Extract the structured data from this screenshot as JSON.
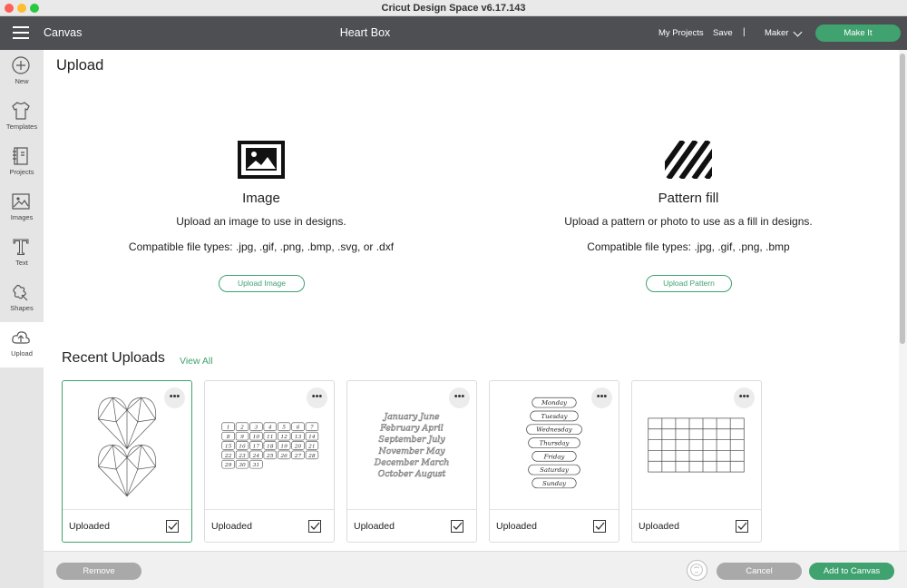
{
  "window": {
    "title": "Cricut Design Space  v6.17.143"
  },
  "header": {
    "menu_icon": "hamburger-icon",
    "section": "Canvas",
    "project_title": "Heart Box",
    "my_projects": "My Projects",
    "save": "Save",
    "separator": "|",
    "machine": "Maker",
    "make_it": "Make It"
  },
  "sidebar": {
    "items": [
      {
        "label": "New",
        "icon": "plus-circle-icon"
      },
      {
        "label": "Templates",
        "icon": "shirt-icon"
      },
      {
        "label": "Projects",
        "icon": "notebook-icon"
      },
      {
        "label": "Images",
        "icon": "image-icon"
      },
      {
        "label": "Text",
        "icon": "text-icon"
      },
      {
        "label": "Shapes",
        "icon": "shapes-icon"
      },
      {
        "label": "Upload",
        "icon": "upload-cloud-icon",
        "active": true
      }
    ]
  },
  "main": {
    "title": "Upload",
    "image_upload": {
      "title": "Image",
      "description": "Upload an image to use in designs.",
      "types": "Compatible file types: .jpg, .gif, .png, .bmp, .svg, or .dxf",
      "button": "Upload Image"
    },
    "pattern_upload": {
      "title": "Pattern fill",
      "description": "Upload a pattern or photo to use as a fill in designs.",
      "types": "Compatible file types: .jpg, .gif, .png, .bmp",
      "button": "Upload Pattern"
    },
    "recent": {
      "title": "Recent Uploads",
      "view_all": "View All",
      "more_label": "•••",
      "items": [
        {
          "label": "Uploaded",
          "thumb": "geometric-hearts",
          "selected": true
        },
        {
          "label": "Uploaded",
          "thumb": "number-tags",
          "numbers": [
            "1",
            "2",
            "3",
            "4",
            "5",
            "6",
            "7",
            "8",
            "9",
            "10",
            "11",
            "12",
            "13",
            "14",
            "15",
            "16",
            "17",
            "18",
            "19",
            "20",
            "21",
            "22",
            "23",
            "24",
            "25",
            "26",
            "27",
            "28",
            "29",
            "30",
            "31"
          ]
        },
        {
          "label": "Uploaded",
          "thumb": "month-script",
          "words": [
            "January",
            "June",
            "February",
            "April",
            "September",
            "July",
            "November",
            "May",
            "December",
            "March",
            "October",
            "August"
          ]
        },
        {
          "label": "Uploaded",
          "thumb": "weekday-tags",
          "words": [
            "Monday",
            "Tuesday",
            "Wednesday",
            "Thursday",
            "Friday",
            "Saturday",
            "Sunday"
          ]
        },
        {
          "label": "Uploaded",
          "thumb": "calendar-grid"
        }
      ]
    }
  },
  "footer": {
    "remove": "Remove",
    "cancel": "Cancel",
    "add_to_canvas": "Add to Canvas"
  },
  "colors": {
    "accent": "#3fa26f",
    "header_bg": "#4d4f52",
    "sidebar_bg": "#e5e5e5"
  }
}
